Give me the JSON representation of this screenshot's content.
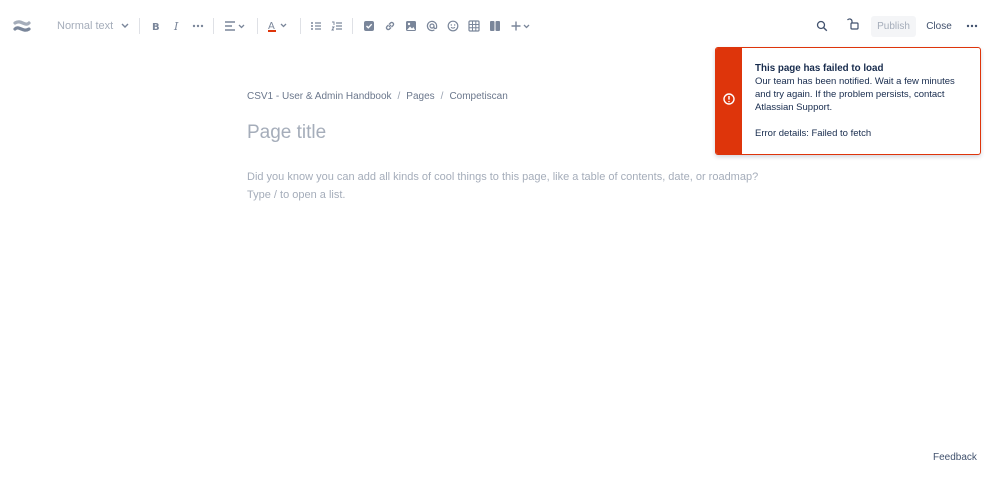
{
  "toolbar": {
    "text_style": "Normal text",
    "publish_label": "Publish",
    "close_label": "Close"
  },
  "breadcrumb": {
    "items": [
      "CSV1 - User & Admin Handbook",
      "Pages",
      "Competiscan"
    ],
    "separator": "/"
  },
  "page": {
    "title_placeholder": "Page title",
    "hint_line1": "Did you know you can add all kinds of cool things to this page, like a table of contents, date, or roadmap?",
    "hint_line2": "Type / to open a list."
  },
  "error_flag": {
    "title": "This page has failed to load",
    "line1": "Our team has been notified. Wait a few minutes",
    "line2": "and try again. If the problem persists, contact",
    "line3": "Atlassian Support.",
    "details": "Error details: Failed to fetch",
    "accent_color": "#de350b"
  },
  "footer": {
    "feedback_label": "Feedback"
  }
}
